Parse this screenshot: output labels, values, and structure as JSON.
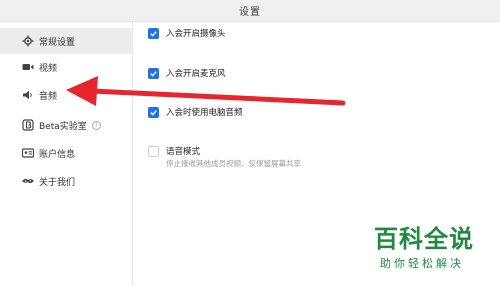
{
  "window": {
    "title": "设置"
  },
  "sidebar": {
    "items": [
      {
        "label": "常规设置",
        "icon": "gear-icon",
        "active": true
      },
      {
        "label": "视频",
        "icon": "video-camera-icon",
        "active": false
      },
      {
        "label": "音频",
        "icon": "speaker-icon",
        "active": false
      },
      {
        "label": "Beta实验室",
        "icon": "beta-icon",
        "active": false
      },
      {
        "label": "账户信息",
        "icon": "id-card-icon",
        "active": false
      },
      {
        "label": "关于我们",
        "icon": "about-logo-icon",
        "active": false
      }
    ],
    "help_glyph": "?"
  },
  "settings": {
    "options": [
      {
        "label": "入会开启摄像头",
        "checked": true
      },
      {
        "label": "入会开启麦克风",
        "checked": true
      },
      {
        "label": "入会时使用电脑音频",
        "checked": true
      },
      {
        "label": "语音模式",
        "checked": false,
        "description": "停止接收其他成员视频，仅保留屏幕共享"
      }
    ]
  },
  "annotation": {
    "color": "#e8242c"
  },
  "watermark": {
    "main": "百科全说",
    "sub": "助你轻松解决",
    "color": "#1c8c3c"
  },
  "colors": {
    "accent": "#1a73e8"
  }
}
